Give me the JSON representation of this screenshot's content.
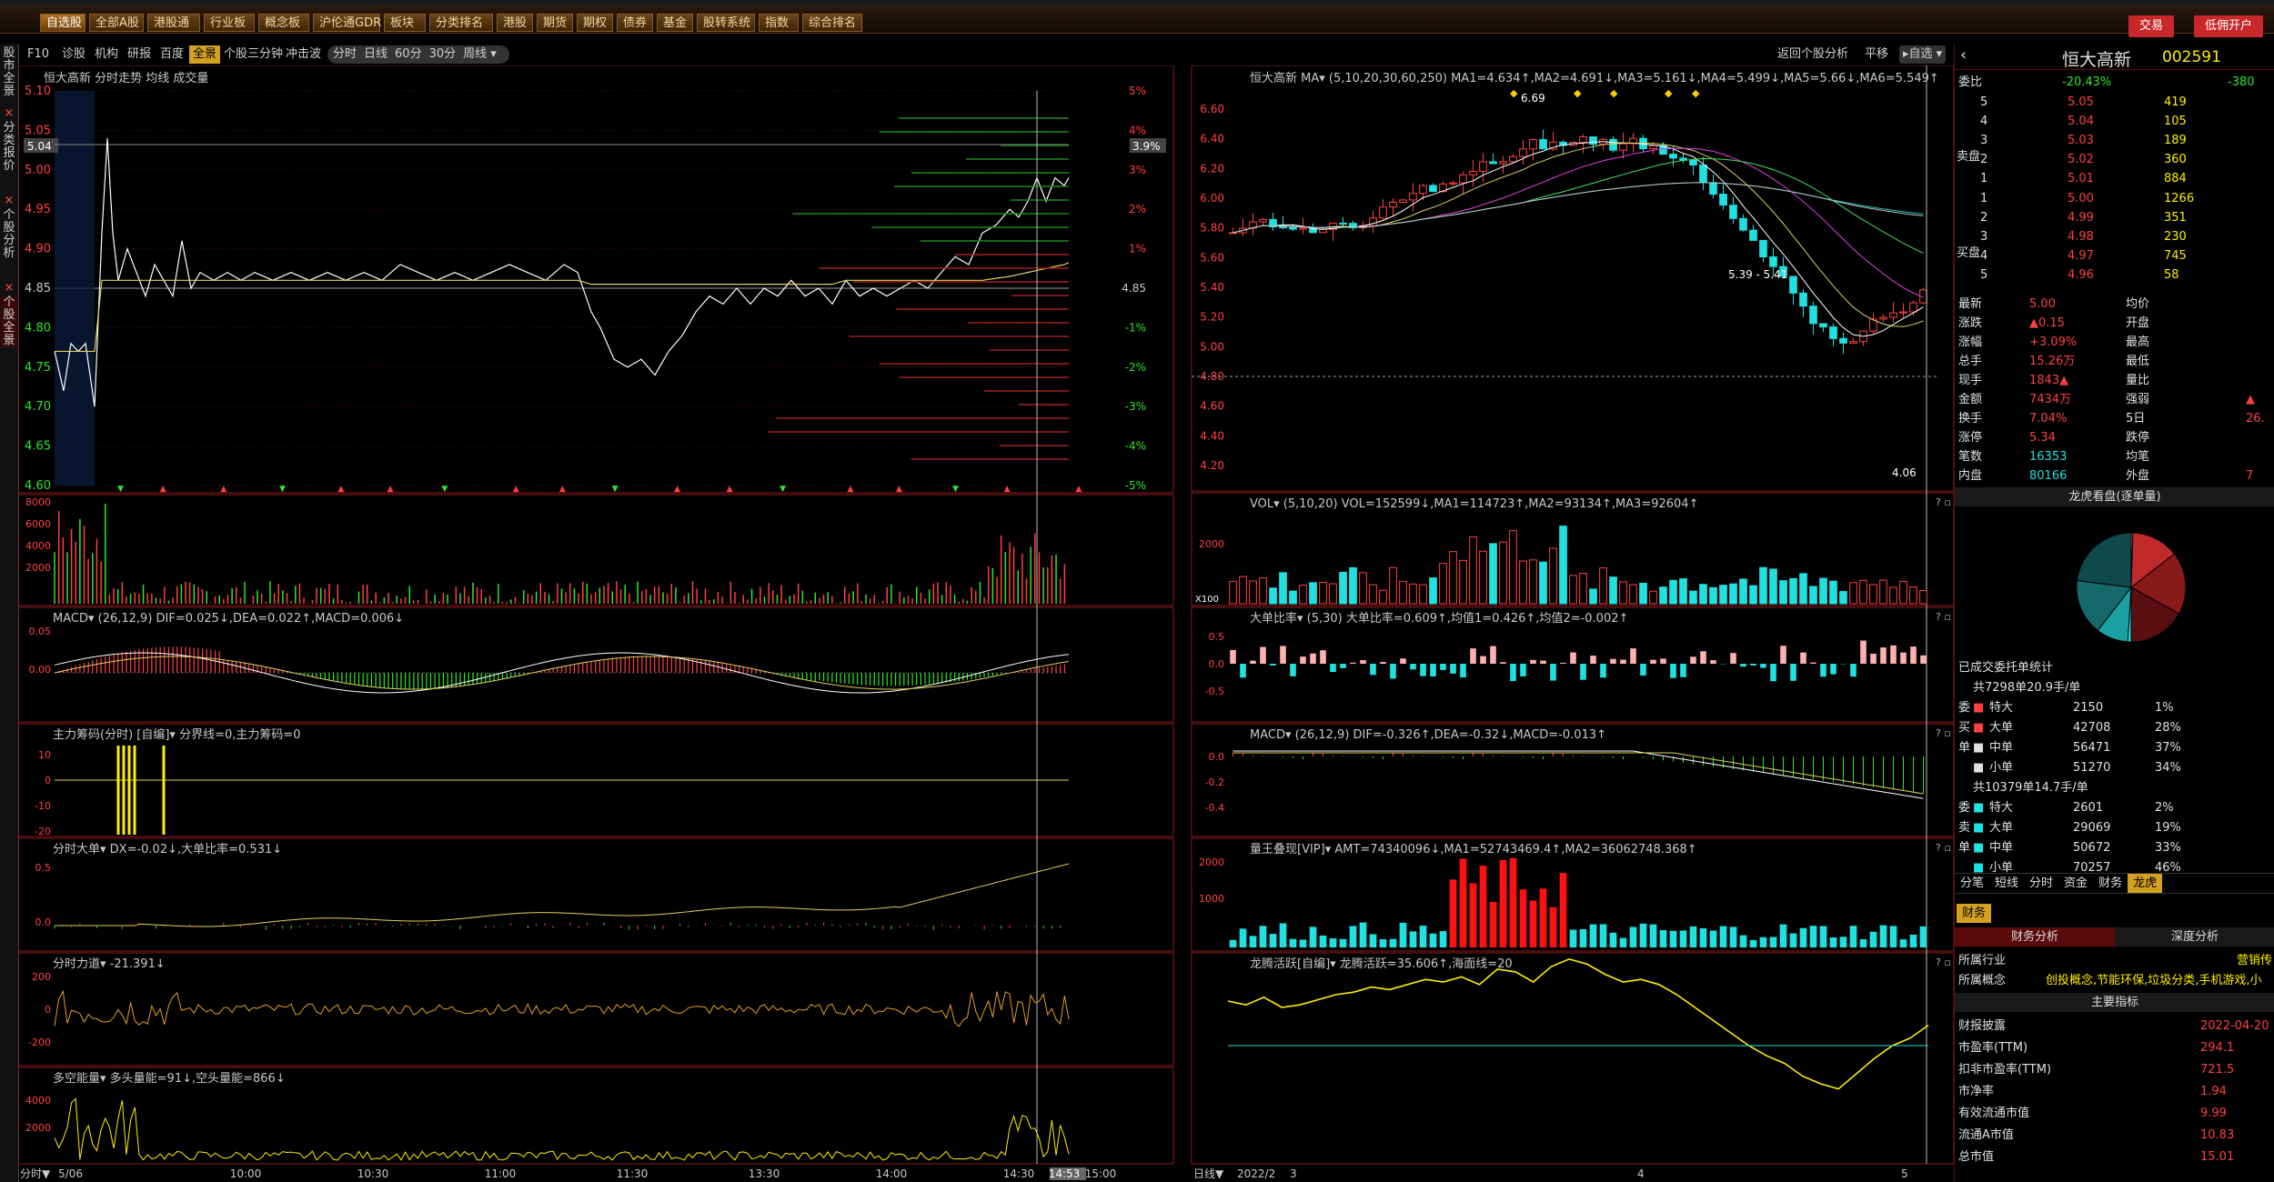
{
  "toolbar": {
    "items": [
      "自选股",
      "全部A股",
      "港股通",
      "行业板",
      "概念板",
      "沪伦通GDR",
      "板块",
      "分类排名",
      "港股",
      "期货",
      "期权",
      "债券",
      "基金",
      "股转系统",
      "指数",
      "综合排名"
    ],
    "trade_label": "交易",
    "open_account_label": "低佣开户"
  },
  "left_strip": {
    "market_label": "股市全景",
    "category_label": "分类报价",
    "stock_analysis_label": "个股分析",
    "stock_full_label": "个股全景"
  },
  "subbar": {
    "left_items": [
      "F10",
      "诊股",
      "机构",
      "研报",
      "百度",
      "全景",
      "个股三分钟",
      "冲击波"
    ],
    "left_selected": "全景",
    "periods": [
      "分时",
      "日线",
      "60分",
      "30分",
      "周线"
    ],
    "right_items": [
      "返回个股分析",
      "平移",
      "自选"
    ]
  },
  "intraday": {
    "header": "恒大高新  分时走势 均线 成交量",
    "price_ticks": [
      "5.10",
      "5.05",
      "5.00",
      "4.95",
      "4.90",
      "4.85",
      "4.80",
      "4.75",
      "4.70",
      "4.65",
      "4.60"
    ],
    "pct_ticks": [
      "5%",
      "4%",
      "3%",
      "2%",
      "1%",
      "4.85",
      "-1%",
      "-2%",
      "-3%",
      "-4%",
      "-5%"
    ],
    "current_price_tag": "5.04",
    "current_pct_tag": "3.9%",
    "vol_ticks": [
      "8000",
      "6000",
      "4000",
      "2000"
    ],
    "macd_header": "MACD▾ (26,12,9)  DIF=0.025↓,DEA=0.022↑,MACD=0.006↓",
    "macd_ticks": [
      "0.05",
      "0.00"
    ],
    "zlcm_header": "主力筹码(分时) [自编]▾ 分界线=0,主力筹码=0",
    "zlcm_ticks": [
      "10",
      "0",
      "-10",
      "-20"
    ],
    "dadan_header": "分时大单▾ DX=-0.02↓,大单比率=0.531↓",
    "dadan_ticks": [
      "0.5",
      "0.0"
    ],
    "lidao_header": "分时力道▾ -21.391↓",
    "lidao_ticks": [
      "200",
      "0",
      "-200"
    ],
    "duokong_header": "多空能量▾ 多头量能=91↓,空头量能=866↓",
    "duokong_ticks": [
      "4000",
      "2000"
    ],
    "time_labels": [
      "5/06",
      "10:00",
      "10:30",
      "11:00",
      "11:30",
      "13:30",
      "14:00",
      "14:30",
      "14:53",
      "15:00"
    ],
    "time_label_left": "分时"
  },
  "daily": {
    "header": "恒大高新  MA▾ (5,10,20,30,60,250)  MA1=4.634↑,MA2=4.691↓,MA3=5.161↓,MA4=5.499↓,MA5=5.66↓,MA6=5.549↑",
    "price_ticks": [
      "6.60",
      "6.40",
      "6.20",
      "6.00",
      "5.80",
      "5.60",
      "5.40",
      "5.20",
      "5.00",
      "4.80",
      "4.60",
      "4.40",
      "4.20"
    ],
    "high_label": "6.69",
    "low_label": "4.06",
    "range_label": "5.39 - 5.41",
    "vol_header": "VOL▾ (5,10,20)  VOL=152599↓,MA1=114723↑,MA2=93134↑,MA3=92604↑",
    "vol_ticks": [
      "2000"
    ],
    "vol_unit": "X100",
    "ddbl_header": "大单比率▾ (5,30)  大单比率=0.609↑,均值1=0.426↑,均值2=-0.002↑",
    "ddbl_ticks": [
      "0.5",
      "0.0",
      "-0.5"
    ],
    "macd_header": "MACD▾ (26,12,9)  DIF=-0.326↑,DEA=-0.32↓,MACD=-0.013↑",
    "macd_ticks": [
      "0.0",
      "-0.2",
      "-0.4"
    ],
    "lwd_header": "量王叠现[VIP]▾ AMT=74340096↓,MA1=52743469.4↑,MA2=36062748.368↑",
    "lwd_ticks": [
      "2000",
      "1000"
    ],
    "lthy_header": "龙腾活跃[自编]▾ 龙腾活跃=35.606↑,海面线=20",
    "date_labels": [
      "2022/2",
      "3",
      "4",
      "5"
    ],
    "date_label_left": "日线"
  },
  "quote": {
    "name": "恒大高新",
    "code": "002591",
    "weibi_label": "委比",
    "weibi_value": "-20.43%",
    "weibi_count": "-380",
    "sell": [
      {
        "label": "5",
        "price": "5.05",
        "vol": "419"
      },
      {
        "label": "4",
        "price": "5.04",
        "vol": "105"
      },
      {
        "label": "3",
        "price": "5.03",
        "vol": "189"
      },
      {
        "label": "2",
        "price": "5.02",
        "vol": "360"
      },
      {
        "label": "1",
        "price": "5.01",
        "vol": "884"
      }
    ],
    "buy": [
      {
        "label": "1",
        "price": "5.00",
        "vol": "1266"
      },
      {
        "label": "2",
        "price": "4.99",
        "vol": "351"
      },
      {
        "label": "3",
        "price": "4.98",
        "vol": "230"
      },
      {
        "label": "4",
        "price": "4.97",
        "vol": "745"
      },
      {
        "label": "5",
        "price": "4.96",
        "vol": "58"
      }
    ],
    "sell_side_label": "卖盘",
    "buy_side_label": "买盘",
    "stats": [
      {
        "k1": "最新",
        "v1": "5.00",
        "k2": "均价",
        "v2": ""
      },
      {
        "k1": "涨跌",
        "v1": "▲0.15",
        "k2": "开盘",
        "v2": ""
      },
      {
        "k1": "涨幅",
        "v1": "+3.09%",
        "k2": "最高",
        "v2": ""
      },
      {
        "k1": "总手",
        "v1": "15.26万",
        "k2": "最低",
        "v2": ""
      },
      {
        "k1": "现手",
        "v1": "1843▲",
        "k2": "量比",
        "v2": ""
      },
      {
        "k1": "金额",
        "v1": "7434万",
        "k2": "强弱",
        "v2": "▲"
      },
      {
        "k1": "换手",
        "v1": "7.04%",
        "k2": "5日",
        "v2": "26."
      },
      {
        "k1": "涨停",
        "v1": "5.34",
        "k2": "跌停",
        "v2": ""
      },
      {
        "k1": "笔数",
        "v1": "16353",
        "k2": "均笔",
        "v2": ""
      },
      {
        "k1": "内盘",
        "v1": "80166",
        "k2": "外盘",
        "v2": "7"
      }
    ],
    "lhb_title": "龙虎看盘(逐单量)",
    "order_stats_title": "已成交委托单统计",
    "buy_total": "共7298单20.9手/单",
    "buy_rows": [
      {
        "k": "特大",
        "v": "2150",
        "p": "1%"
      },
      {
        "k": "大单",
        "v": "42708",
        "p": "28%"
      },
      {
        "k": "中单",
        "v": "56471",
        "p": "37%"
      },
      {
        "k": "小单",
        "v": "51270",
        "p": "34%"
      }
    ],
    "buy_side_chars": [
      "委",
      "买",
      "单"
    ],
    "sell_total": "共10379单14.7手/单",
    "sell_rows": [
      {
        "k": "特大",
        "v": "2601",
        "p": "2%"
      },
      {
        "k": "大单",
        "v": "29069",
        "p": "19%"
      },
      {
        "k": "中单",
        "v": "50672",
        "p": "33%"
      },
      {
        "k": "小单",
        "v": "70257",
        "p": "46%"
      }
    ],
    "sell_side_chars": [
      "委",
      "卖",
      "单"
    ],
    "tabs": [
      "分笔",
      "短线",
      "分时",
      "资金",
      "财务",
      "龙虎"
    ],
    "tab_selected": "龙虎",
    "fin_tab": "财务",
    "fin_subtabs": [
      "财务分析",
      "深度分析"
    ],
    "industry_label": "所属行业",
    "industry_value": "营销传",
    "concept_label": "所属概念",
    "concept_value": "创投概念,节能环保,垃圾分类,手机游戏,小",
    "main_index_label": "主要指标",
    "fin_rows": [
      {
        "k": "财报披露",
        "v": "2022-04-20"
      },
      {
        "k": "市盈率(TTM)",
        "v": "294.1"
      },
      {
        "k": "扣非市盈率(TTM)",
        "v": "721.5"
      },
      {
        "k": "市净率",
        "v": "1.94"
      },
      {
        "k": "有效流通市值",
        "v": "9.99"
      },
      {
        "k": "流通A市值",
        "v": "10.83"
      },
      {
        "k": "总市值",
        "v": "15.01"
      }
    ]
  },
  "pie": {
    "values": [
      1,
      28,
      37,
      34,
      2,
      19,
      33,
      46
    ]
  }
}
